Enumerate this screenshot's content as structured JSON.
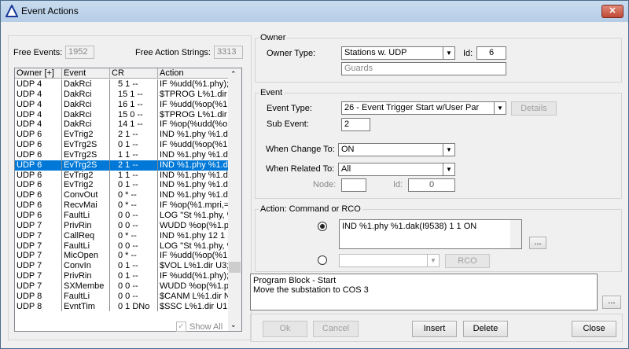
{
  "window": {
    "title": "Event Actions",
    "close": "✕"
  },
  "left": {
    "free_events_label": "Free Events:",
    "free_events": "1952",
    "free_actions_label": "Free Action Strings:",
    "free_actions": "3313",
    "columns": [
      "Owner [+]",
      "Event",
      "CR",
      "Action"
    ],
    "rows": [
      [
        "UDP 4",
        "DakRci",
        "5 1 --",
        "IF %udd(%1.phy);$"
      ],
      [
        "UDP 4",
        "DakRci",
        "15 1 --",
        "$TPROG L%1.dir U"
      ],
      [
        "UDP 4",
        "DakRci",
        "16 1 --",
        "IF %udd(%op(%1.pl"
      ],
      [
        "UDP 4",
        "DakRci",
        "15 0 --",
        "$TPROG L%1.dir U"
      ],
      [
        "UDP 4",
        "DakRci",
        "14 1 --",
        "IF %op(%udd(%op("
      ],
      [
        "UDP 6",
        "EvTrig2",
        "2 1 --",
        "IND %1.phy %1.da"
      ],
      [
        "UDP 6",
        "EvTrg2S",
        "0 1 --",
        "IF %udd(%op(%1.pl"
      ],
      [
        "UDP 6",
        "EvTrg2S",
        "1 1 --",
        "IND %1.phy %1.da"
      ],
      [
        "UDP 6",
        "EvTrg2S",
        "2 1 --",
        "IND %1.phy %1.da"
      ],
      [
        "UDP 6",
        "EvTrig2",
        "1 1 --",
        "IND %1.phy %1.da"
      ],
      [
        "UDP 6",
        "EvTrig2",
        "0 1 --",
        "IND %1.phy %1.da"
      ],
      [
        "UDP 6",
        "ConvOut",
        "0 * --",
        "IND %1.phy %1.da"
      ],
      [
        "UDP 6",
        "RecvMai",
        "0 * --",
        "IF %op(%1.mpri,=,4"
      ],
      [
        "UDP 6",
        "FaultLi",
        "0 0 --",
        "LOG \"St %1.phy, %"
      ],
      [
        "UDP 7",
        "PrivRin",
        "0 0 --",
        "WUDD %op(%1.ph"
      ],
      [
        "UDP 7",
        "CallReq",
        "0 * --",
        "IND %1.phy 12 1 3"
      ],
      [
        "UDP 7",
        "FaultLi",
        "0 0 --",
        "LOG \"St %1.phy, %"
      ],
      [
        "UDP 7",
        "MicOpen",
        "0 * --",
        "IF %udd(%op(%1.pl"
      ],
      [
        "UDP 7",
        "ConvIn",
        "0 1 --",
        "$VOL L%1.dir U3;I"
      ],
      [
        "UDP 7",
        "PrivRin",
        "0 1 --",
        "IF %udd(%1.phy);$I"
      ],
      [
        "UDP 7",
        "SXMembe",
        "0 0 --",
        "WUDD %op(%1.ph"
      ],
      [
        "UDP 8",
        "FaultLi",
        "0 0 --",
        "$CANM L%1.dir NC"
      ],
      [
        "UDP 8",
        "EvntTim",
        "0 1 DNo",
        "$SSC L%1.dir U1;C"
      ]
    ],
    "selected_index": 8,
    "show_all": "Show All"
  },
  "owner": {
    "group": "Owner",
    "type_label": "Owner Type:",
    "type": "Stations w. UDP",
    "id_label": "Id:",
    "id": "6",
    "name": "Guards"
  },
  "event": {
    "group": "Event",
    "type_label": "Event Type:",
    "type": "26 - Event Trigger Start w/User Par",
    "details": "Details",
    "sub_label": "Sub Event:",
    "sub": "2",
    "change_label": "When Change To:",
    "change": "ON",
    "related_label": "When Related To:",
    "related": "All",
    "node_label": "Node:",
    "node": "",
    "id_label": "Id:",
    "id": "0"
  },
  "action": {
    "group": "Action: Command or RCO",
    "command": "IND %1.phy %1.dak(I9538) 1 1 ON",
    "more": "...",
    "rco": "",
    "rco_button": "RCO"
  },
  "description": {
    "line1": "Program Block - Start",
    "line2": "Move the substation to COS 3",
    "more": "..."
  },
  "buttons": {
    "ok": "Ok",
    "cancel": "Cancel",
    "insert": "Insert",
    "delete": "Delete",
    "close": "Close"
  }
}
